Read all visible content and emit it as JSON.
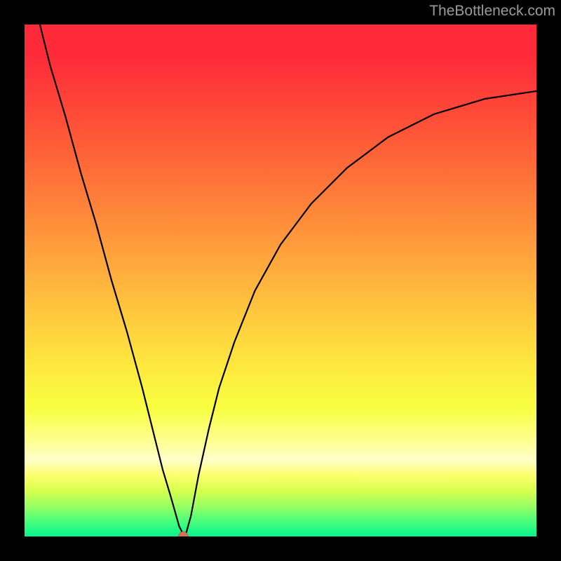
{
  "watermark_text": "TheBottleneck.com",
  "chart_data": {
    "type": "line",
    "title": "",
    "xlabel": "",
    "ylabel": "",
    "xlim": [
      0,
      100
    ],
    "ylim": [
      0,
      100
    ],
    "x": [
      3,
      5,
      8,
      11,
      14,
      17,
      20,
      23,
      25,
      27,
      28.5,
      29.5,
      30.2,
      30.8,
      31.2,
      31.6,
      32.5,
      34,
      36,
      38,
      41,
      45,
      50,
      56,
      63,
      71,
      80,
      90,
      100
    ],
    "values": [
      100,
      92,
      82,
      71,
      61,
      50,
      40,
      29,
      21,
      13,
      8,
      4.5,
      2,
      0.8,
      0.2,
      0.8,
      4,
      12,
      21,
      29,
      38,
      48,
      57,
      65,
      72,
      78,
      82.5,
      85.5,
      87
    ],
    "minimum_point": {
      "x": 31.0,
      "y": 0
    },
    "note": "V-shaped bottleneck curve; y-axis inverted visually (0 at bottom = best / green, 100 at top = worst / red). Values estimated from pixel positions."
  },
  "colors": {
    "background": "#000000",
    "gradient_top": "#fe2a3a",
    "gradient_bottom": "#06f58d",
    "curve": "#000000",
    "dot_fill": "#d47159"
  }
}
